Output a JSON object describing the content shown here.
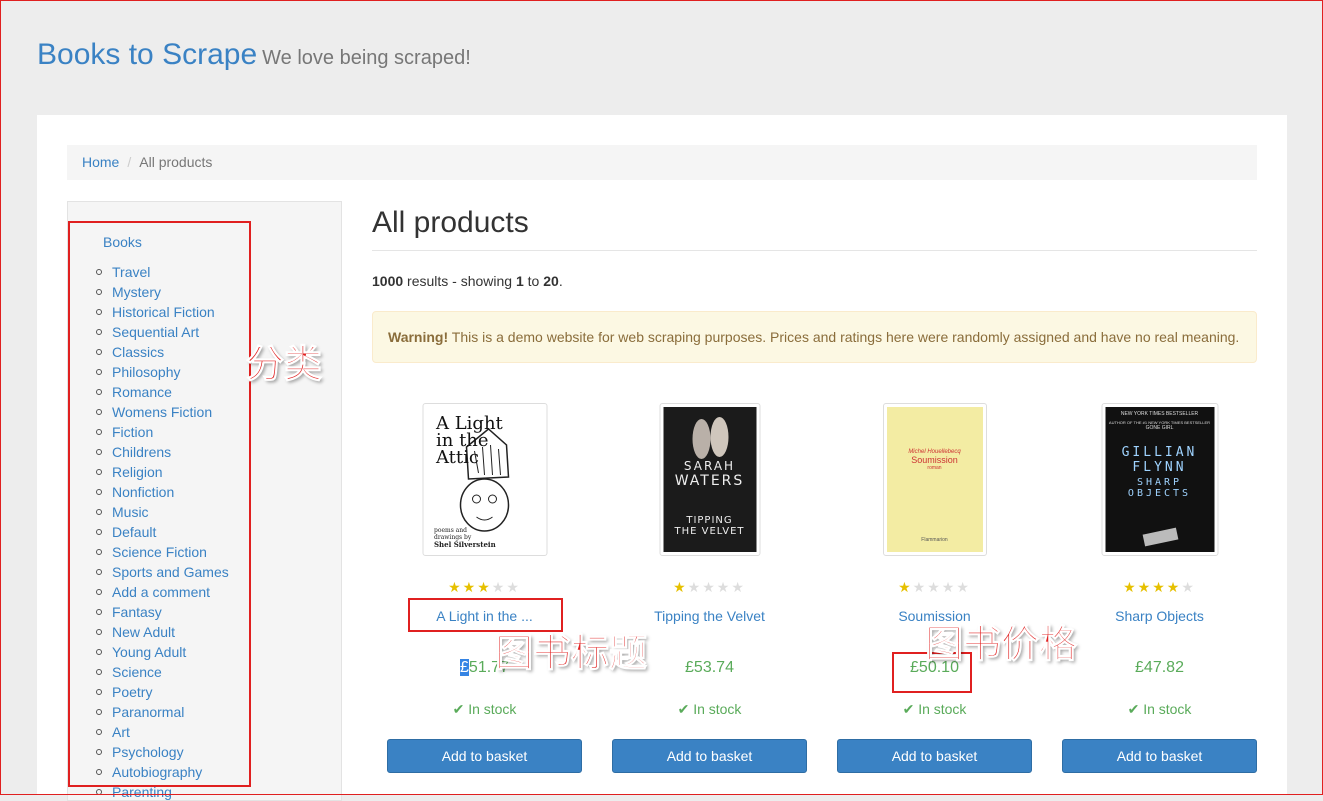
{
  "header": {
    "brand": "Books to Scrape",
    "tagline": "We love being scraped!"
  },
  "breadcrumb": {
    "home": "Home",
    "current": "All products"
  },
  "sidebar": {
    "root": "Books",
    "categories": [
      "Travel",
      "Mystery",
      "Historical Fiction",
      "Sequential Art",
      "Classics",
      "Philosophy",
      "Romance",
      "Womens Fiction",
      "Fiction",
      "Childrens",
      "Religion",
      "Nonfiction",
      "Music",
      "Default",
      "Science Fiction",
      "Sports and Games",
      "Add a comment",
      "Fantasy",
      "New Adult",
      "Young Adult",
      "Science",
      "Poetry",
      "Paranormal",
      "Art",
      "Psychology",
      "Autobiography",
      "Parenting"
    ]
  },
  "main": {
    "title": "All products",
    "results": {
      "total": "1000",
      "mid1": "results - showing",
      "from": "1",
      "mid2": "to",
      "to": "20",
      "end": "."
    },
    "warning": {
      "strong": "Warning!",
      "text": "This is a demo website for web scraping purposes. Prices and ratings here were randomly assigned and have no real meaning."
    }
  },
  "products": [
    {
      "title": "A Light in the ...",
      "price_sel": "£",
      "price_rest": "51.77",
      "rating": 3,
      "stock": "In stock",
      "button": "Add to basket",
      "cover": {
        "l1": "A Light",
        "l2": "in the",
        "l3": "Attic",
        "l4": "poems and",
        "l5": "drawings by",
        "l6": "Shel Silverstein"
      }
    },
    {
      "title": "Tipping the Velvet",
      "price": "£53.74",
      "rating": 1,
      "stock": "In stock",
      "button": "Add to basket",
      "cover": {
        "l1": "SARAH",
        "l2": "WATERS",
        "l3": "TIPPING",
        "l4": "THE VELVET"
      }
    },
    {
      "title": "Soumission",
      "price": "£50.10",
      "rating": 1,
      "stock": "In stock",
      "button": "Add to basket",
      "cover": {
        "l1": "Michel Houellebecq",
        "l2": "Soumission",
        "l3": "roman",
        "l4": "Flammarion"
      }
    },
    {
      "title": "Sharp Objects",
      "price": "£47.82",
      "rating": 4,
      "stock": "In stock",
      "button": "Add to basket",
      "cover": {
        "l1": "NEW YORK TIMES BESTSELLER",
        "l2": "AUTHOR OF THE #1 NEW YORK TIMES BESTSELLER",
        "l3": "GONE GIRL",
        "l4": "GILLIAN",
        "l5": "FLYNN",
        "l6": "SHARP",
        "l7": "OBJECTS"
      }
    }
  ],
  "annotations": {
    "category": "分类",
    "book_title": "图书标题",
    "book_price": "图书价格"
  },
  "colors": {
    "link": "#3a82c4",
    "price": "#5aab5a",
    "annotation": "#e02020",
    "star": "#e6c000"
  },
  "icons": {
    "in_stock": "check-icon",
    "rating": "star-icon"
  }
}
